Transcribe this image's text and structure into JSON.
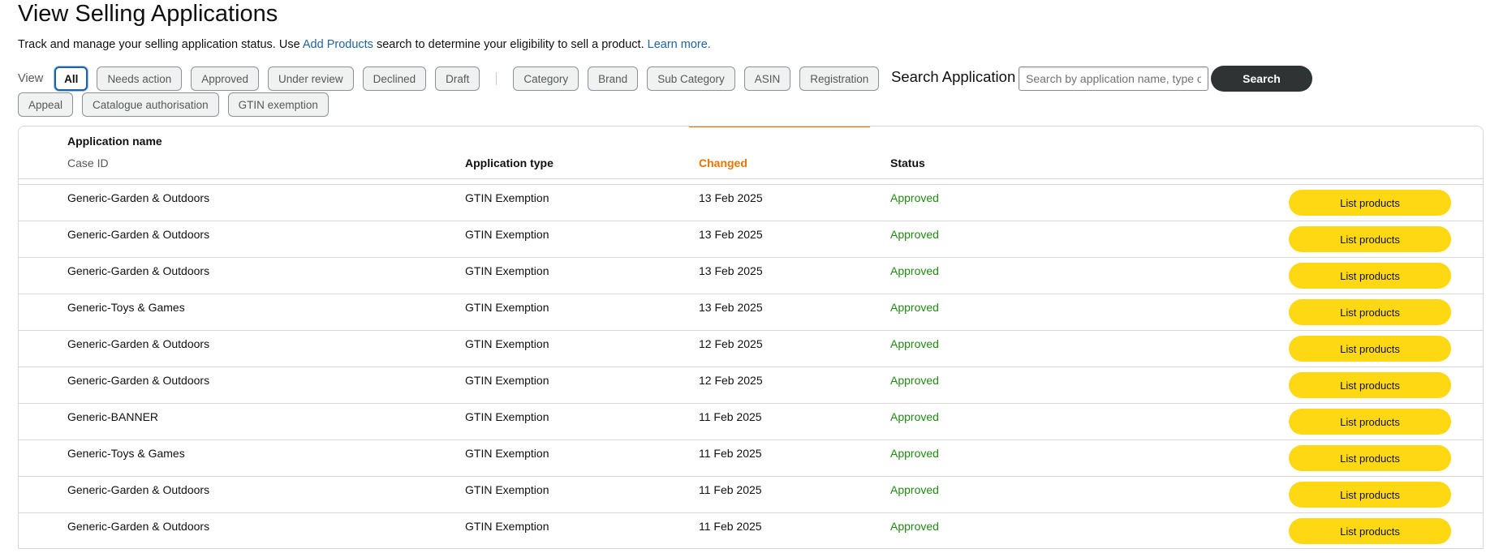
{
  "header": {
    "title": "View Selling Applications",
    "subtitle_before": "Track and manage your selling application status. Use ",
    "subtitle_link": "Add Products",
    "subtitle_after": " search to determine your eligibility to sell a product. ",
    "learn_more": "Learn more."
  },
  "filters": {
    "view_label": "View",
    "status_chips": [
      "All",
      "Needs action",
      "Approved",
      "Under review",
      "Declined",
      "Draft"
    ],
    "type_chips": [
      "Category",
      "Brand",
      "Sub Category",
      "ASIN",
      "Registration"
    ],
    "type_chips_row2": [
      "Appeal",
      "Catalogue authorisation",
      "GTIN exemption"
    ],
    "active": "All"
  },
  "search": {
    "label": "Search Application",
    "placeholder": "Search by application name, type or case ID",
    "button": "Search"
  },
  "table": {
    "columns": {
      "name": "Application name",
      "case_id": "Case ID",
      "type": "Application type",
      "changed": "Changed",
      "status": "Status"
    },
    "sorted_by": "Changed",
    "rows": [
      {
        "name": "Generic-Garden & Outdoors",
        "type": "GTIN Exemption",
        "changed": "13 Feb 2025",
        "status": "Approved",
        "action": "List products"
      },
      {
        "name": "Generic-Garden & Outdoors",
        "type": "GTIN Exemption",
        "changed": "13 Feb 2025",
        "status": "Approved",
        "action": "List products"
      },
      {
        "name": "Generic-Garden & Outdoors",
        "type": "GTIN Exemption",
        "changed": "13 Feb 2025",
        "status": "Approved",
        "action": "List products"
      },
      {
        "name": "Generic-Toys & Games",
        "type": "GTIN Exemption",
        "changed": "13 Feb 2025",
        "status": "Approved",
        "action": "List products"
      },
      {
        "name": "Generic-Garden & Outdoors",
        "type": "GTIN Exemption",
        "changed": "12 Feb 2025",
        "status": "Approved",
        "action": "List products"
      },
      {
        "name": "Generic-Garden & Outdoors",
        "type": "GTIN Exemption",
        "changed": "12 Feb 2025",
        "status": "Approved",
        "action": "List products"
      },
      {
        "name": "Generic-BANNER",
        "type": "GTIN Exemption",
        "changed": "11 Feb 2025",
        "status": "Approved",
        "action": "List products"
      },
      {
        "name": "Generic-Toys & Games",
        "type": "GTIN Exemption",
        "changed": "11 Feb 2025",
        "status": "Approved",
        "action": "List products"
      },
      {
        "name": "Generic-Garden & Outdoors",
        "type": "GTIN Exemption",
        "changed": "11 Feb 2025",
        "status": "Approved",
        "action": "List products"
      },
      {
        "name": "Generic-Garden & Outdoors",
        "type": "GTIN Exemption",
        "changed": "11 Feb 2025",
        "status": "Approved",
        "action": "List products"
      }
    ]
  },
  "colors": {
    "link": "#2162a1",
    "sort_accent": "#e77600",
    "approved": "#208a12",
    "primary_button": "#ffd814",
    "search_button": "#303333"
  }
}
